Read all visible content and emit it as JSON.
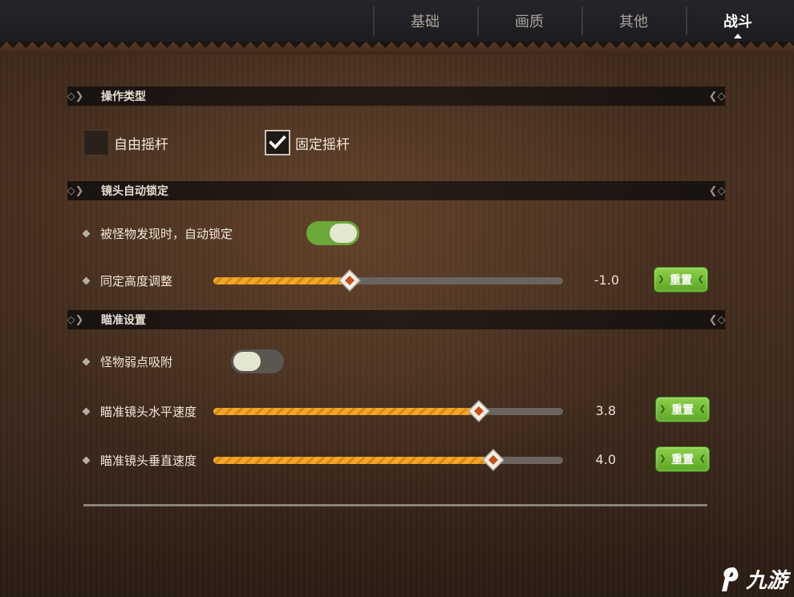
{
  "tabs": [
    {
      "label": "基础",
      "active": false
    },
    {
      "label": "画质",
      "active": false
    },
    {
      "label": "其他",
      "active": false
    },
    {
      "label": "战斗",
      "active": true
    }
  ],
  "sections": {
    "operation": {
      "title": "操作类型"
    },
    "camera_lock": {
      "title": "镜头自动锁定"
    },
    "aim": {
      "title": "瞄准设置"
    }
  },
  "operation": {
    "free_stick": {
      "label": "自由摇杆",
      "checked": false
    },
    "fixed_stick": {
      "label": "固定摇杆",
      "checked": true
    }
  },
  "camera_lock": {
    "auto_lock": {
      "label": "被怪物发现时，自动锁定",
      "on": true
    },
    "height": {
      "label": "同定高度调整",
      "value": "-1.0",
      "fraction": 0.39,
      "reset_label": "重置"
    }
  },
  "aim": {
    "weak_point": {
      "label": "怪物弱点吸附",
      "on": false
    },
    "horizontal": {
      "label": "瞄准镜头水平速度",
      "value": "3.8",
      "fraction": 0.76,
      "reset_label": "重置"
    },
    "vertical": {
      "label": "瞄准镜头垂直速度",
      "value": "4.0",
      "fraction": 0.8,
      "reset_label": "重置"
    }
  },
  "watermark": {
    "text": "九游"
  },
  "colors": {
    "accent_green": "#6aa839",
    "slider_orange": "#f0a72a",
    "thumb_accent": "#c8501e"
  }
}
